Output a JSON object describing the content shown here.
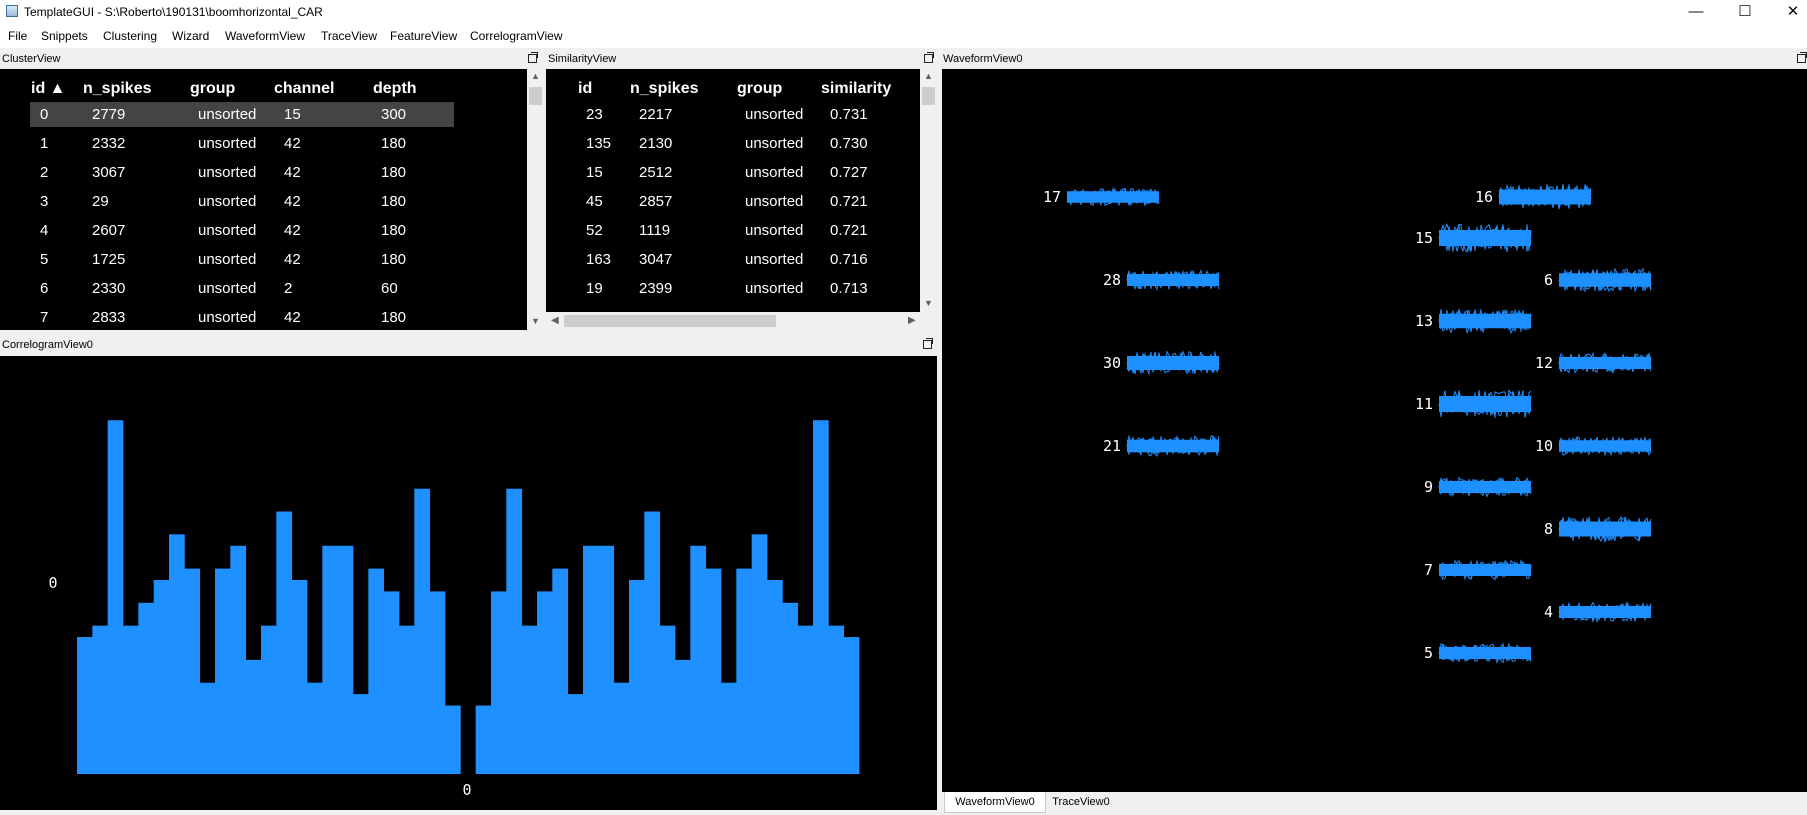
{
  "window": {
    "title": "TemplateGUI - S:\\Roberto\\190131\\boomhorizontal_CAR",
    "minimize": "—",
    "maximize": "☐",
    "close": "✕"
  },
  "menu": [
    "File",
    "Snippets",
    "Clustering",
    "Wizard",
    "WaveformView",
    "TraceView",
    "FeatureView",
    "CorrelogramView"
  ],
  "cluster_view": {
    "title": "ClusterView",
    "headers": [
      "id ▲",
      "n_spikes",
      "group",
      "channel",
      "depth"
    ],
    "rows": [
      [
        "0",
        "2779",
        "unsorted",
        "15",
        "300"
      ],
      [
        "1",
        "2332",
        "unsorted",
        "42",
        "180"
      ],
      [
        "2",
        "3067",
        "unsorted",
        "42",
        "180"
      ],
      [
        "3",
        "29",
        "unsorted",
        "42",
        "180"
      ],
      [
        "4",
        "2607",
        "unsorted",
        "42",
        "180"
      ],
      [
        "5",
        "1725",
        "unsorted",
        "42",
        "180"
      ],
      [
        "6",
        "2330",
        "unsorted",
        "2",
        "60"
      ],
      [
        "7",
        "2833",
        "unsorted",
        "42",
        "180"
      ]
    ],
    "selected_row": 0
  },
  "similarity_view": {
    "title": "SimilarityView",
    "headers": [
      "id",
      "n_spikes",
      "group",
      "similarity"
    ],
    "rows": [
      [
        "23",
        "2217",
        "unsorted",
        "0.731"
      ],
      [
        "135",
        "2130",
        "unsorted",
        "0.730"
      ],
      [
        "15",
        "2512",
        "unsorted",
        "0.727"
      ],
      [
        "45",
        "2857",
        "unsorted",
        "0.721"
      ],
      [
        "52",
        "1119",
        "unsorted",
        "0.721"
      ],
      [
        "163",
        "3047",
        "unsorted",
        "0.716"
      ],
      [
        "19",
        "2399",
        "unsorted",
        "0.713"
      ]
    ]
  },
  "waveform_view": {
    "title": "WaveformView0",
    "tabs": [
      "WaveformView0",
      "TraceView0"
    ],
    "channels": [
      {
        "label": "17",
        "amp": 0.55
      },
      {
        "label": "16",
        "amp": 0.9
      },
      {
        "label": "15",
        "amp": 1.0
      },
      {
        "label": "28",
        "amp": 0.6
      },
      {
        "label": "6",
        "amp": 0.75
      },
      {
        "label": "13",
        "amp": 0.85
      },
      {
        "label": "30",
        "amp": 0.8
      },
      {
        "label": "12",
        "amp": 0.6
      },
      {
        "label": "11",
        "amp": 1.0
      },
      {
        "label": "21",
        "amp": 0.65
      },
      {
        "label": "10",
        "amp": 0.55
      },
      {
        "label": "9",
        "amp": 0.6
      },
      {
        "label": "8",
        "amp": 0.9
      },
      {
        "label": "7",
        "amp": 0.6
      },
      {
        "label": "4",
        "amp": 0.6
      },
      {
        "label": "5",
        "amp": 0.6
      }
    ],
    "waveform_color": "#1e90ff"
  },
  "correlogram_view": {
    "title": "CorrelogramView0",
    "ylabel": "0",
    "xlabel": "0",
    "bar_color": "#1e90ff",
    "chart_data": {
      "type": "bar",
      "title": "",
      "xlabel": "0",
      "ylabel": "0",
      "values": [
        12,
        13,
        31,
        13,
        15,
        17,
        21,
        18,
        8,
        18,
        20,
        10,
        13,
        23,
        17,
        8,
        20,
        20,
        7,
        18,
        16,
        13,
        25,
        16,
        6,
        0,
        6,
        16,
        25,
        13,
        16,
        18,
        7,
        20,
        20,
        8,
        17,
        23,
        13,
        10,
        20,
        18,
        8,
        18,
        21,
        17,
        15,
        13,
        31,
        13,
        12
      ],
      "ylim": [
        0,
        34
      ]
    }
  }
}
